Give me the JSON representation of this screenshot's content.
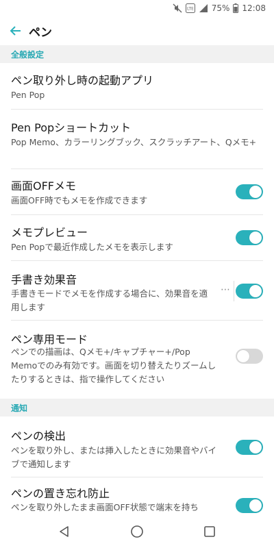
{
  "status_bar": {
    "battery_percent": "75%",
    "time": "12:08",
    "lte_label": "LTE"
  },
  "app_bar": {
    "title": "ペン"
  },
  "sections": {
    "general": "全般設定",
    "notify": "通知"
  },
  "items": [
    {
      "title": "ペン取り外し時の起動アプリ",
      "subtitle": "Pen Pop"
    },
    {
      "title": "Pen Popショートカット",
      "subtitle": "Pop Memo、カラーリングブック、スクラッチアート、Qメモ+"
    },
    {
      "title": "画面OFFメモ",
      "subtitle": "画面OFF時でもメモを作成できます",
      "toggle": "on"
    },
    {
      "title": "メモプレビュー",
      "subtitle": "Pen Popで最近作成したメモを表示します",
      "toggle": "on"
    },
    {
      "title": "手書き効果音",
      "subtitle": "手書きモードでメモを作成する場合に、効果音を適用します",
      "toggle": "on"
    },
    {
      "title": "ペン専用モード",
      "subtitle": "ペンでの描画は、Qメモ+/キャプチャー+/Pop Memoでのみ有効です。画面を切り替えたりズームしたりするときは、指で操作してください",
      "toggle": "off"
    },
    {
      "title": "ペンの検出",
      "subtitle": "ペンを取り外し、または挿入したときに効果音やバイブで通知します",
      "toggle": "on"
    },
    {
      "title": "ペンの置き忘れ防止",
      "subtitle": "ペンを取り外したまま画面OFF状態で端末を持ち",
      "toggle": "on"
    }
  ],
  "colors": {
    "accent": "#2ab1bb",
    "section_text": "#29a9b4",
    "toggle_off": "#d8d8d8",
    "section_bg": "#f1f1f1"
  },
  "icons": {
    "back": "arrow-left-icon",
    "more": "more-horizontal-icon",
    "nav_back": "triangle-back-icon",
    "nav_home": "circle-home-icon",
    "nav_recents": "square-recents-icon"
  }
}
